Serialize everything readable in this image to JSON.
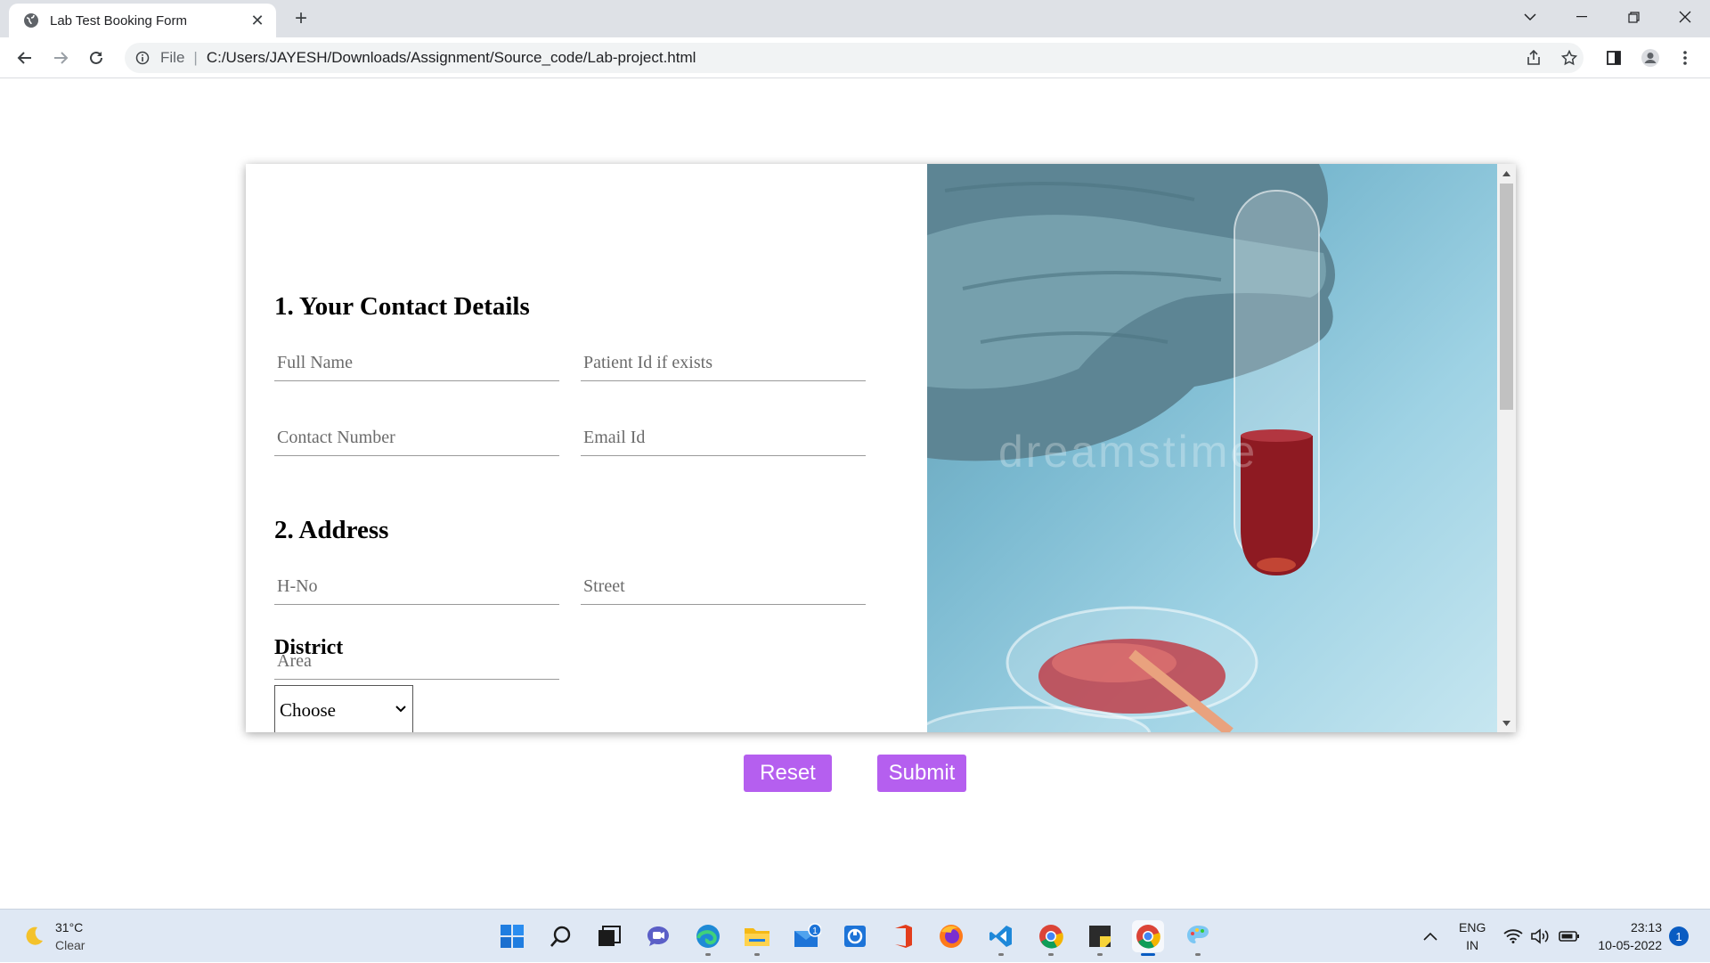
{
  "browser": {
    "tab_title": "Lab Test Booking Form",
    "address_scheme": "File",
    "address_url": "C:/Users/JAYESH/Downloads/Assignment/Source_code/Lab-project.html"
  },
  "form": {
    "section1_title": "1. Your Contact Details",
    "full_name_placeholder": "Full Name",
    "patient_id_placeholder": "Patient Id if exists",
    "contact_number_placeholder": "Contact Number",
    "email_placeholder": "Email Id",
    "section2_title": "2. Address",
    "hno_placeholder": "H-No",
    "street_placeholder": "Street",
    "area_placeholder": "Area",
    "district_label": "District",
    "district_selected": "Choose",
    "image_watermark": "dreamstime"
  },
  "buttons": {
    "reset_label": "Reset",
    "submit_label": "Submit"
  },
  "taskbar": {
    "temperature": "31°C",
    "condition": "Clear",
    "mail_badge": "1",
    "language": "ENG",
    "region": "IN",
    "time": "23:13",
    "date": "10-05-2022",
    "notification_count": "1"
  },
  "colors": {
    "button_bg": "#b55fef",
    "tab_strip": "#dee1e6",
    "taskbar": "#dfe8f4"
  }
}
